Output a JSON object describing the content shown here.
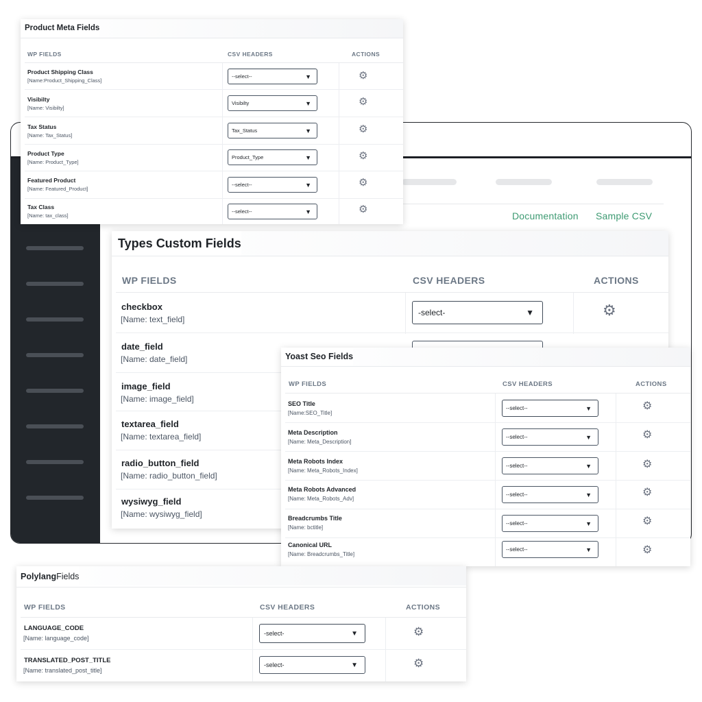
{
  "app": {
    "links": {
      "documentation": "Documentation",
      "sample_csv": "Sample CSV"
    }
  },
  "product_meta": {
    "title": "Product Meta Fields",
    "headers": {
      "wp": "WP FIELDS",
      "csv": "CSV HEADERS",
      "actions": "ACTIONS"
    },
    "rows": [
      {
        "name": "Product Shipping Class",
        "sub": "[Name:Product_Shipping_Class]",
        "select": "--select--"
      },
      {
        "name": "Visibilty",
        "sub": "[Name: Visibilty]",
        "select": "Visibilty"
      },
      {
        "name": "Tax Status",
        "sub": "[Name: Tax_Status]",
        "select": "Tax_Status"
      },
      {
        "name": "Product Type",
        "sub": "[Name: Product_Type]",
        "select": "Product_Type"
      },
      {
        "name": "Featured Product",
        "sub": "[Name: Featured_Product]",
        "select": "--select--"
      },
      {
        "name": "Tax Class",
        "sub": "[Name: tax_class]",
        "select": "--select--"
      }
    ]
  },
  "types_custom": {
    "title": "Types Custom Fields",
    "headers": {
      "wp": "WP FIELDS",
      "csv": "CSV HEADERS",
      "actions": "ACTIONS"
    },
    "rows": [
      {
        "name": "checkbox",
        "sub": "[Name: text_field]",
        "select": "-select-"
      },
      {
        "name": "date_field",
        "sub": "[Name: date_field]"
      },
      {
        "name": "image_field",
        "sub": "[Name: image_field]"
      },
      {
        "name": "textarea_field",
        "sub": "[Name: textarea_field]"
      },
      {
        "name": "radio_button_field",
        "sub": "[Name: radio_button_field]"
      },
      {
        "name": "wysiwyg_field",
        "sub": "[Name: wysiwyg_field]"
      }
    ]
  },
  "yoast": {
    "title": "Yoast Seo Fields",
    "headers": {
      "wp": "WP FIELDS",
      "csv": "CSV HEADERS",
      "actions": "ACTIONS"
    },
    "rows": [
      {
        "name": "SEO Title",
        "sub": "[Name:SEO_Title]",
        "select": "--select--"
      },
      {
        "name": "Meta Description",
        "sub": "[Name: Meta_Description]",
        "select": "--select--"
      },
      {
        "name": "Meta Robots Index",
        "sub": "[Name: Meta_Robots_Index]",
        "select": "--select--"
      },
      {
        "name": "Meta Robots Advanced",
        "sub": "[Name: Meta_Robots_Adv]",
        "select": "--select--"
      },
      {
        "name": "Breadcrumbs Title",
        "sub": "[Name: bctitle]",
        "select": "--select--"
      },
      {
        "name": "Canonical URL",
        "sub": "[Name: Breadcrumbs_Title]",
        "select": "--select--"
      }
    ]
  },
  "polylang": {
    "title_bold": "Polylang",
    "title_rest": " Fields",
    "headers": {
      "wp": "WP FIELDS",
      "csv": "CSV HEADERS",
      "actions": "ACTIONS"
    },
    "rows": [
      {
        "name": "LANGUAGE_CODE",
        "sub": "[Name: language_code]",
        "select": "-select-"
      },
      {
        "name": "TRANSLATED_POST_TITLE",
        "sub": "[Name: translated_post_title]",
        "select": "-select-"
      }
    ]
  },
  "icons": {
    "gear": "gear-icon",
    "caret": "caret-down-icon"
  },
  "colors": {
    "accent_link": "#3d9a72",
    "sidebar": "#22262b",
    "header_text": "#6b7785"
  }
}
